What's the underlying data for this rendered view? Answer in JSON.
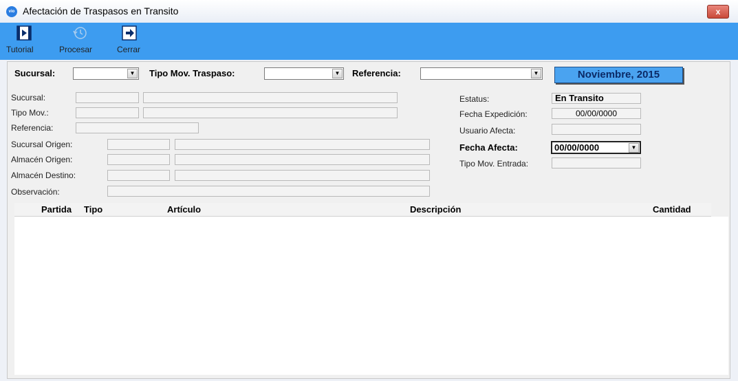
{
  "window": {
    "app_icon": "vio",
    "title": "Afectación de Traspasos en Transito",
    "close": "x"
  },
  "toolbar": {
    "tutorial": "Tutorial",
    "procesar": "Procesar",
    "cerrar": "Cerrar"
  },
  "top_filters": {
    "sucursal_label": "Sucursal:",
    "tipo_mov_label": "Tipo Mov. Traspaso:",
    "referencia_label": "Referencia:",
    "period": "Noviembre, 2015"
  },
  "details": {
    "sucursal": "Sucursal:",
    "tipo_mov": "Tipo Mov.:",
    "referencia": "Referencia:",
    "sucursal_origen": "Sucursal Origen:",
    "almacen_origen": "Almacén Origen:",
    "almacen_destino": "Almacén Destino:",
    "observacion": "Observación:"
  },
  "status": {
    "estatus_label": "Estatus:",
    "estatus_value": "En Transito",
    "fecha_expedicion_label": "Fecha Expedición:",
    "fecha_expedicion_value": "00/00/0000",
    "usuario_afecta_label": "Usuario Afecta:",
    "fecha_afecta_label": "Fecha Afecta:",
    "fecha_afecta_value": "00/00/0000",
    "tipo_mov_entrada_label": "Tipo Mov. Entrada:"
  },
  "grid": {
    "columns": [
      "Partida",
      "Tipo",
      "Artículo",
      "Descripción",
      "Cantidad"
    ]
  }
}
